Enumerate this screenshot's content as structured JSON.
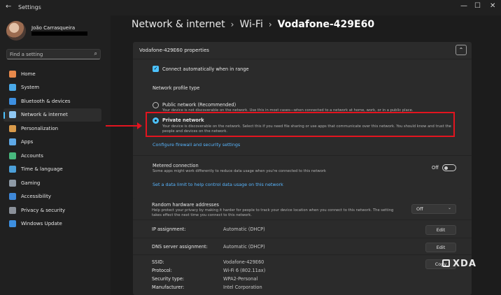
{
  "window": {
    "title": "Settings",
    "back_glyph": "←",
    "minimize_glyph": "—",
    "maximize_glyph": "☐",
    "close_glyph": "✕"
  },
  "profile": {
    "name": "João Carrasqueira"
  },
  "search": {
    "placeholder": "Find a setting",
    "icon": "⌕"
  },
  "sidebar": {
    "items": [
      {
        "label": "Home",
        "icon": "home-icon",
        "color": "#e8894b",
        "active": false
      },
      {
        "label": "System",
        "icon": "monitor-icon",
        "color": "#4aa9e8",
        "active": false
      },
      {
        "label": "Bluetooth & devices",
        "icon": "bluetooth-icon",
        "color": "#3d8fe0",
        "active": false
      },
      {
        "label": "Network & internet",
        "icon": "wifi-icon",
        "color": "#8fc8f3",
        "active": true
      },
      {
        "label": "Personalization",
        "icon": "brush-icon",
        "color": "#d99a4a",
        "active": false
      },
      {
        "label": "Apps",
        "icon": "apps-icon",
        "color": "#5ea8e6",
        "active": false
      },
      {
        "label": "Accounts",
        "icon": "person-icon",
        "color": "#48b87e",
        "active": false
      },
      {
        "label": "Time & language",
        "icon": "globe-clock-icon",
        "color": "#4b9fd8",
        "active": false
      },
      {
        "label": "Gaming",
        "icon": "gamepad-icon",
        "color": "#8e9aa6",
        "active": false
      },
      {
        "label": "Accessibility",
        "icon": "accessibility-icon",
        "color": "#3f88d8",
        "active": false
      },
      {
        "label": "Privacy & security",
        "icon": "shield-icon",
        "color": "#8a9099",
        "active": false
      },
      {
        "label": "Windows Update",
        "icon": "update-icon",
        "color": "#3d8fe0",
        "active": false
      }
    ]
  },
  "breadcrumb": {
    "items": [
      "Network & internet",
      "Wi-Fi",
      "Vodafone-429E60"
    ],
    "separator": "›"
  },
  "properties": {
    "title": "Vodafone-429E60 properties",
    "collapse_glyph": "⌃",
    "auto_connect": {
      "label": "Connect automatically when in range",
      "checked": true,
      "check_glyph": "✓"
    },
    "profile_type_label": "Network profile type",
    "public": {
      "label": "Public network (Recommended)",
      "description": "Your device is not discoverable on the network. Use this in most cases—when connected to a network at home, work, or in a public place."
    },
    "private": {
      "label": "Private network",
      "description_line1": "Your device is discoverable on the network. Select this if you need file sharing or use apps that communicate over this network. You should know and trust the",
      "description_line2": "people and devices on the network."
    },
    "firewall_link": "Configure firewall and security settings",
    "metered": {
      "label": "Metered connection",
      "description": "Some apps might work differently to reduce data usage when you're connected to this network",
      "toggle_label": "Off",
      "on": false
    },
    "data_limit_link": "Set a data limit to help control data usage on this network"
  },
  "random_hw": {
    "label": "Random hardware addresses",
    "description_line1": "Help protect your privacy by making it harder for people to track your device location when you connect to this network. The setting",
    "description_line2": "takes effect the next time you connect to this network.",
    "value": "Off",
    "chevron": "⌄"
  },
  "ip": {
    "label": "IP assignment:",
    "value": "Automatic (DHCP)",
    "button": "Edit"
  },
  "dns": {
    "label": "DNS server assignment:",
    "value": "Automatic (DHCP)",
    "button": "Edit"
  },
  "details": [
    {
      "label": "SSID:",
      "value": "Vodafone-429E60"
    },
    {
      "label": "Protocol:",
      "value": "Wi-Fi 6 (802.11ax)"
    },
    {
      "label": "Security type:",
      "value": "WPA2-Personal"
    },
    {
      "label": "Manufacturer:",
      "value": "Intel Corporation"
    }
  ],
  "copy_button": "Copy",
  "watermark": "XDA",
  "colors": {
    "accent": "#4cc2ff",
    "highlight": "#e3141f",
    "link": "#58b6ff"
  }
}
